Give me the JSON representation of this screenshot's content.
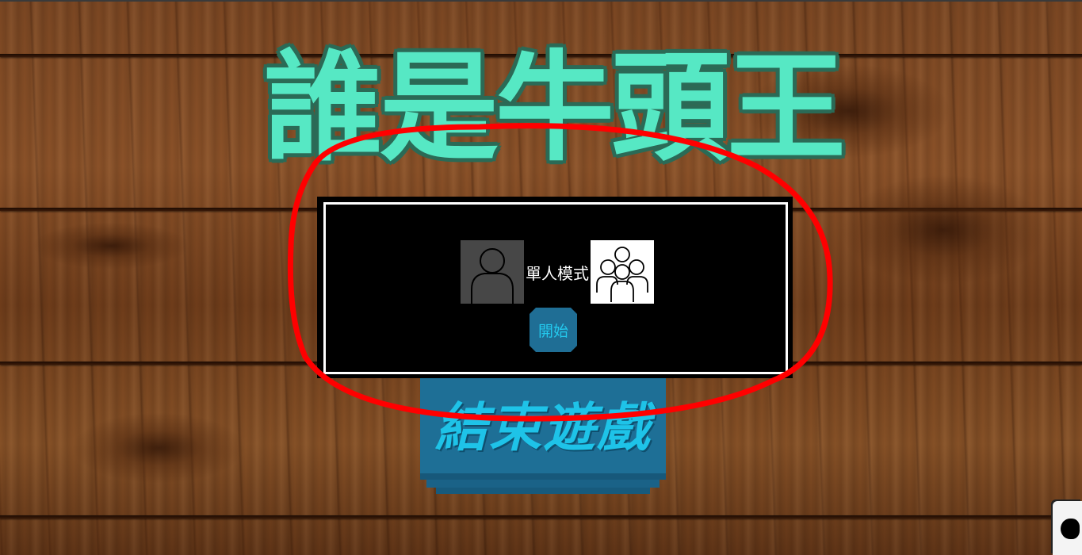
{
  "game": {
    "title": "誰是牛頭王",
    "exit_label": "結束遊戲"
  },
  "mode_dialog": {
    "mode_label": "單人模式",
    "start_label": "開始",
    "single_icon": "single-person-icon",
    "multi_icon": "group-people-icon"
  },
  "colors": {
    "title": "#56e8c4",
    "title_outline": "#2b6a56",
    "button_bg": "#1e6f96",
    "button_text": "#1ec3e8",
    "annotation": "#ff0000",
    "panel_bg": "#000000"
  }
}
